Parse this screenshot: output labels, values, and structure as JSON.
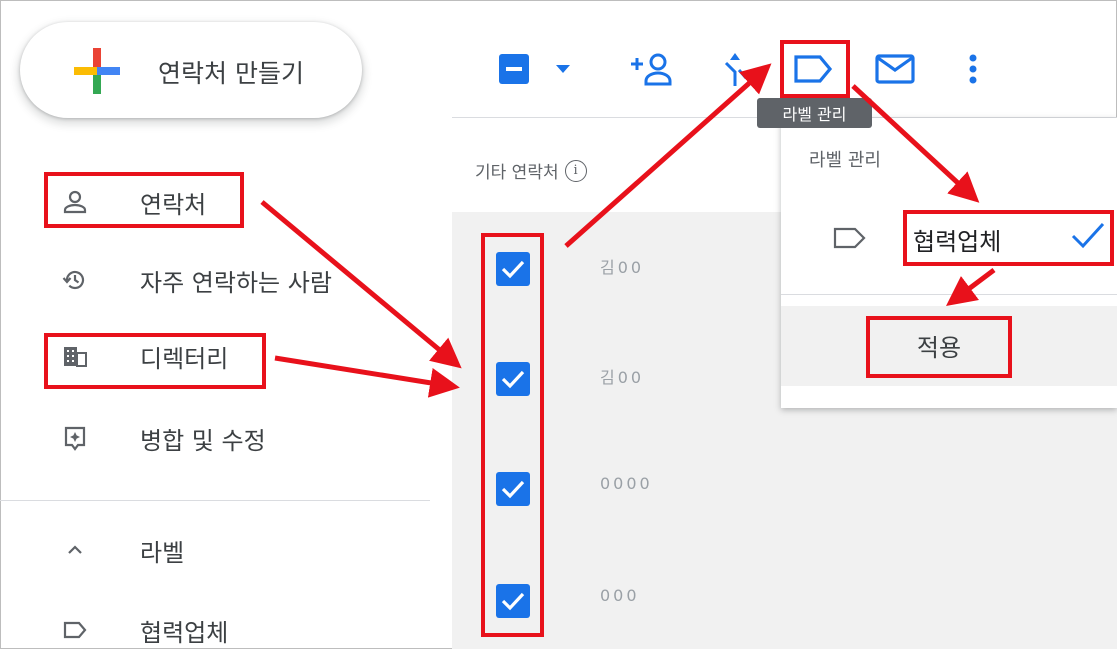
{
  "sidebar": {
    "create_label": "연락처 만들기",
    "items": [
      {
        "label": "연락처",
        "icon": "person-icon"
      },
      {
        "label": "자주 연락하는 사람",
        "icon": "history-icon"
      },
      {
        "label": "디렉터리",
        "icon": "building-icon"
      },
      {
        "label": "병합 및 수정",
        "icon": "merge-fix-icon"
      }
    ],
    "labels_header": "라벨",
    "label_items": [
      {
        "label": "협력업체",
        "icon": "label-icon"
      }
    ]
  },
  "toolbar": {
    "tooltip": "라벨 관리",
    "icons": [
      "select-all-checkbox-icon",
      "dropdown-caret-icon",
      "add-person-icon",
      "merge-icon",
      "label-icon",
      "mail-icon",
      "more-vert-icon"
    ]
  },
  "main": {
    "section_title": "기타 연락처",
    "info_icon": "i",
    "rows": [
      {
        "name": "김00",
        "checked": true
      },
      {
        "name": "김00",
        "checked": true
      },
      {
        "name": "0000",
        "checked": true
      },
      {
        "name": "000",
        "checked": true
      }
    ]
  },
  "label_menu": {
    "title": "라벨 관리",
    "item": "협력업체",
    "item_checked": true,
    "apply": "적용"
  },
  "colors": {
    "accent": "#1a73e8",
    "highlight": "#e8111b",
    "text": "#3c4043"
  }
}
